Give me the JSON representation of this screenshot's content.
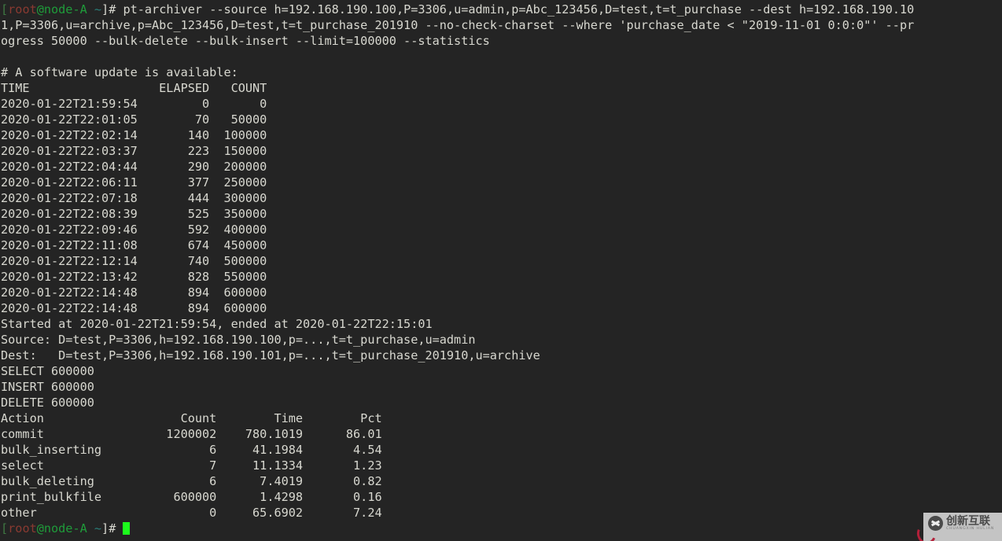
{
  "terminal": {
    "background": "#242424",
    "foreground": "#d8d8d0",
    "cursor_color": "#1cfb1c",
    "prompt": {
      "bracket_open": "[",
      "user": "root",
      "at_host": "@node-A",
      "space_tilde": " ~",
      "bracket_close_symbol": "]# "
    },
    "command_line_1": "pt-archiver --source h=192.168.190.100,P=3306,u=admin,p=Abc_123456,D=test,t=t_purchase --dest h=192.168.190.10",
    "command_line_2": "1,P=3306,u=archive,p=Abc_123456,D=test,t=t_purchase_201910 --no-check-charset --where 'purchase_date < \"2019-11-01 0:0:0\"' --pr",
    "command_line_3": "ogress 50000 --bulk-delete --bulk-insert --limit=100000 --statistics",
    "notice": "# A software update is available:",
    "progress_table": {
      "headers": [
        "TIME",
        "ELAPSED",
        "COUNT"
      ],
      "rows": [
        [
          "2020-01-22T21:59:54",
          "0",
          "0"
        ],
        [
          "2020-01-22T22:01:05",
          "70",
          "50000"
        ],
        [
          "2020-01-22T22:02:14",
          "140",
          "100000"
        ],
        [
          "2020-01-22T22:03:37",
          "223",
          "150000"
        ],
        [
          "2020-01-22T22:04:44",
          "290",
          "200000"
        ],
        [
          "2020-01-22T22:06:11",
          "377",
          "250000"
        ],
        [
          "2020-01-22T22:07:18",
          "444",
          "300000"
        ],
        [
          "2020-01-22T22:08:39",
          "525",
          "350000"
        ],
        [
          "2020-01-22T22:09:46",
          "592",
          "400000"
        ],
        [
          "2020-01-22T22:11:08",
          "674",
          "450000"
        ],
        [
          "2020-01-22T22:12:14",
          "740",
          "500000"
        ],
        [
          "2020-01-22T22:13:42",
          "828",
          "550000"
        ],
        [
          "2020-01-22T22:14:48",
          "894",
          "600000"
        ],
        [
          "2020-01-22T22:14:48",
          "894",
          "600000"
        ]
      ]
    },
    "summary": {
      "started_ended": "Started at 2020-01-22T21:59:54, ended at 2020-01-22T22:15:01",
      "source": "Source: D=test,P=3306,h=192.168.190.100,p=...,t=t_purchase,u=admin",
      "dest": "Dest:   D=test,P=3306,h=192.168.190.101,p=...,t=t_purchase_201910,u=archive",
      "select": "SELECT 600000",
      "insert": "INSERT 600000",
      "delete": "DELETE 600000"
    },
    "action_table": {
      "headers": [
        "Action",
        "Count",
        "Time",
        "Pct"
      ],
      "rows": [
        [
          "commit",
          "1200002",
          "780.1019",
          "86.01"
        ],
        [
          "bulk_inserting",
          "6",
          "41.1984",
          "4.54"
        ],
        [
          "select",
          "7",
          "11.1334",
          "1.23"
        ],
        [
          "bulk_deleting",
          "6",
          "7.4019",
          "0.82"
        ],
        [
          "print_bulkfile",
          "600000",
          "1.4298",
          "0.16"
        ],
        [
          "other",
          "0",
          "65.6902",
          "7.24"
        ]
      ]
    }
  },
  "watermark": {
    "cn_text": "创新互联",
    "en_text": "CHUANGXIN HULIAN"
  }
}
